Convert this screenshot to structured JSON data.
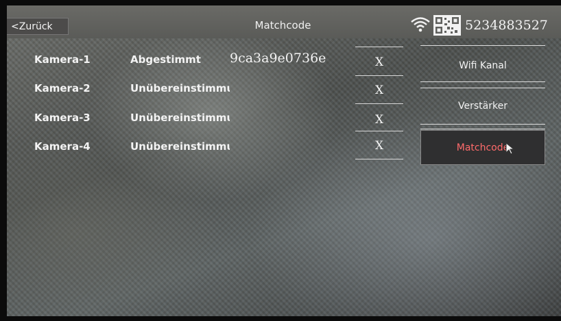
{
  "header": {
    "back_label": "<Zurück",
    "title": "Matchcode",
    "serial": "5234883527"
  },
  "cameras": [
    {
      "label": "Kamera-1",
      "status": "Abgestimmt",
      "code": "9ca3a9e0736e",
      "action": "X"
    },
    {
      "label": "Kamera-2",
      "status": "Unübereinstimmung",
      "code": "",
      "action": "X"
    },
    {
      "label": "Kamera-3",
      "status": "Unübereinstimmung",
      "code": "",
      "action": "X"
    },
    {
      "label": "Kamera-4",
      "status": "Unübereinstimmung",
      "code": "",
      "action": "X"
    }
  ],
  "menu": {
    "wifi": "Wifi Kanal",
    "amplifier": "Verstärker",
    "matchcode": "Matchcode"
  },
  "colors": {
    "active_text": "#ff6b6b"
  }
}
